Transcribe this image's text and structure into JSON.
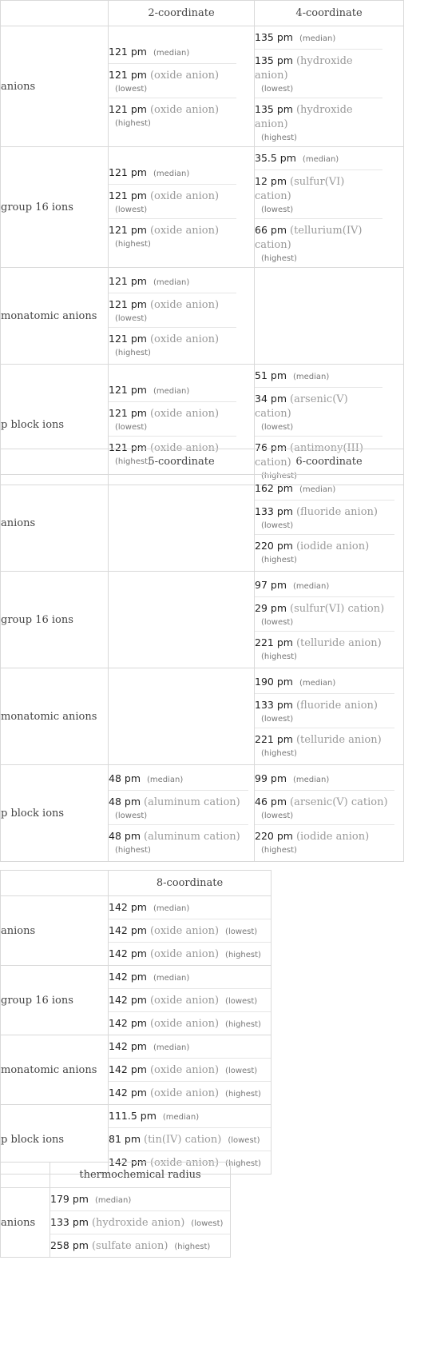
{
  "tables": [
    {
      "columns": [
        "2-coordinate",
        "4-coordinate"
      ],
      "rows": [
        {
          "label": "anions",
          "cells": [
            [
              {
                "value": "121 pm",
                "source": "",
                "tag": "(median)"
              },
              {
                "value": "121 pm",
                "source": "(oxide anion)",
                "tag": "(lowest)"
              },
              {
                "value": "121 pm",
                "source": "(oxide anion)",
                "tag": "(highest)"
              }
            ],
            [
              {
                "value": "135 pm",
                "source": "",
                "tag": "(median)"
              },
              {
                "value": "135 pm",
                "source": "(hydroxide anion)",
                "tag": "(lowest)"
              },
              {
                "value": "135 pm",
                "source": "(hydroxide anion)",
                "tag": "(highest)"
              }
            ]
          ]
        },
        {
          "label": "group 16 ions",
          "cells": [
            [
              {
                "value": "121 pm",
                "source": "",
                "tag": "(median)"
              },
              {
                "value": "121 pm",
                "source": "(oxide anion)",
                "tag": "(lowest)"
              },
              {
                "value": "121 pm",
                "source": "(oxide anion)",
                "tag": "(highest)"
              }
            ],
            [
              {
                "value": "35.5 pm",
                "source": "",
                "tag": "(median)"
              },
              {
                "value": "12 pm",
                "source": "(sulfur(VI) cation)",
                "tag": "(lowest)"
              },
              {
                "value": "66 pm",
                "source": "(tellurium(IV) cation)",
                "tag": "(highest)"
              }
            ]
          ]
        },
        {
          "label": "monatomic anions",
          "cells": [
            [
              {
                "value": "121 pm",
                "source": "",
                "tag": "(median)"
              },
              {
                "value": "121 pm",
                "source": "(oxide anion)",
                "tag": "(lowest)"
              },
              {
                "value": "121 pm",
                "source": "(oxide anion)",
                "tag": "(highest)"
              }
            ],
            []
          ]
        },
        {
          "label": "p block ions",
          "cells": [
            [
              {
                "value": "121 pm",
                "source": "",
                "tag": "(median)"
              },
              {
                "value": "121 pm",
                "source": "(oxide anion)",
                "tag": "(lowest)"
              },
              {
                "value": "121 pm",
                "source": "(oxide anion)",
                "tag": "(highest)"
              }
            ],
            [
              {
                "value": "51 pm",
                "source": "",
                "tag": "(median)"
              },
              {
                "value": "34 pm",
                "source": "(arsenic(V) cation)",
                "tag": "(lowest)"
              },
              {
                "value": "76 pm",
                "source": "(antimony(III) cation)",
                "tag": "(highest)"
              }
            ]
          ]
        }
      ]
    },
    {
      "columns": [
        "5-coordinate",
        "6-coordinate"
      ],
      "rows": [
        {
          "label": "anions",
          "cells": [
            [],
            [
              {
                "value": "162 pm",
                "source": "",
                "tag": "(median)"
              },
              {
                "value": "133 pm",
                "source": "(fluoride anion)",
                "tag": "(lowest)"
              },
              {
                "value": "220 pm",
                "source": "(iodide anion)",
                "tag": "(highest)"
              }
            ]
          ]
        },
        {
          "label": "group 16 ions",
          "cells": [
            [],
            [
              {
                "value": "97 pm",
                "source": "",
                "tag": "(median)"
              },
              {
                "value": "29 pm",
                "source": "(sulfur(VI) cation)",
                "tag": "(lowest)"
              },
              {
                "value": "221 pm",
                "source": "(telluride anion)",
                "tag": "(highest)"
              }
            ]
          ]
        },
        {
          "label": "monatomic anions",
          "cells": [
            [],
            [
              {
                "value": "190 pm",
                "source": "",
                "tag": "(median)"
              },
              {
                "value": "133 pm",
                "source": "(fluoride anion)",
                "tag": "(lowest)"
              },
              {
                "value": "221 pm",
                "source": "(telluride anion)",
                "tag": "(highest)"
              }
            ]
          ]
        },
        {
          "label": "p block ions",
          "cells": [
            [
              {
                "value": "48 pm",
                "source": "",
                "tag": "(median)"
              },
              {
                "value": "48 pm",
                "source": "(aluminum cation)",
                "tag": "(lowest)"
              },
              {
                "value": "48 pm",
                "source": "(aluminum cation)",
                "tag": "(highest)"
              }
            ],
            [
              {
                "value": "99 pm",
                "source": "",
                "tag": "(median)"
              },
              {
                "value": "46 pm",
                "source": "(arsenic(V) cation)",
                "tag": "(lowest)"
              },
              {
                "value": "220 pm",
                "source": "(iodide anion)",
                "tag": "(highest)"
              }
            ]
          ]
        }
      ]
    },
    {
      "columns": [
        "8-coordinate"
      ],
      "rows": [
        {
          "label": "anions",
          "cells": [
            [
              {
                "value": "142 pm",
                "source": "",
                "tag": "(median)"
              },
              {
                "value": "142 pm",
                "source": "(oxide anion)",
                "tag": "(lowest)"
              },
              {
                "value": "142 pm",
                "source": "(oxide anion)",
                "tag": "(highest)"
              }
            ]
          ]
        },
        {
          "label": "group 16 ions",
          "cells": [
            [
              {
                "value": "142 pm",
                "source": "",
                "tag": "(median)"
              },
              {
                "value": "142 pm",
                "source": "(oxide anion)",
                "tag": "(lowest)"
              },
              {
                "value": "142 pm",
                "source": "(oxide anion)",
                "tag": "(highest)"
              }
            ]
          ]
        },
        {
          "label": "monatomic anions",
          "cells": [
            [
              {
                "value": "142 pm",
                "source": "",
                "tag": "(median)"
              },
              {
                "value": "142 pm",
                "source": "(oxide anion)",
                "tag": "(lowest)"
              },
              {
                "value": "142 pm",
                "source": "(oxide anion)",
                "tag": "(highest)"
              }
            ]
          ]
        },
        {
          "label": "p block ions",
          "cells": [
            [
              {
                "value": "111.5 pm",
                "source": "",
                "tag": "(median)"
              },
              {
                "value": "81 pm",
                "source": "(tin(IV) cation)",
                "tag": "(lowest)"
              },
              {
                "value": "142 pm",
                "source": "(oxide anion)",
                "tag": "(highest)"
              }
            ]
          ]
        }
      ]
    },
    {
      "columns": [
        "thermochemical radius"
      ],
      "rows": [
        {
          "label": "anions",
          "cells": [
            [
              {
                "value": "179 pm",
                "source": "",
                "tag": "(median)"
              },
              {
                "value": "133 pm",
                "source": "(hydroxide anion)",
                "tag": "(lowest)"
              },
              {
                "value": "258 pm",
                "source": "(sulfate anion)",
                "tag": "(highest)"
              }
            ]
          ]
        }
      ]
    }
  ]
}
